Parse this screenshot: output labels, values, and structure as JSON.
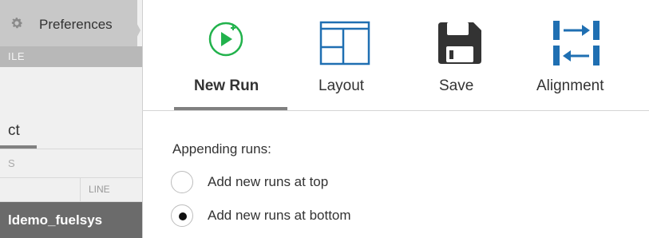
{
  "left_panel": {
    "preferences_label": "Preferences",
    "file_header": "ILE",
    "active_tab_fragment": "ct",
    "section_fragment": "S",
    "column_line": "LINE",
    "model_name": "ldemo_fuelsys"
  },
  "toolbar": {
    "new_run": "New Run",
    "layout": "Layout",
    "save": "Save",
    "alignment": "Alignment"
  },
  "appending": {
    "title": "Appending runs:",
    "options": [
      {
        "label": "Add new runs at top",
        "selected": false
      },
      {
        "label": "Add new runs at bottom",
        "selected": true
      }
    ]
  },
  "colors": {
    "new_run_accent": "#22b24c",
    "layout_accent": "#1f6fb2",
    "alignment_accent": "#1f6fb2",
    "save_icon": "#333333"
  },
  "icons": {
    "preferences": "gear-icon",
    "new_run": "play-plus-icon",
    "layout": "layout-grid-icon",
    "save": "floppy-disk-icon",
    "alignment": "alignment-arrows-icon"
  }
}
